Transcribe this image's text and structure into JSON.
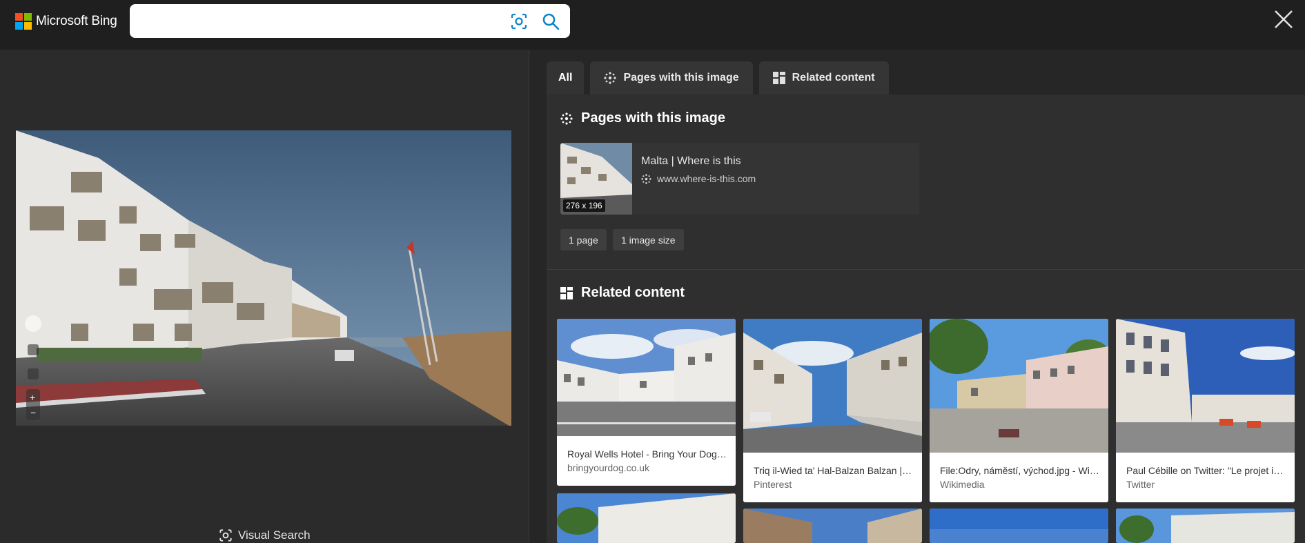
{
  "header": {
    "logo_text": "Microsoft Bing",
    "search": {
      "value": "",
      "placeholder": ""
    },
    "icons": [
      "visual-search-icon",
      "search-icon",
      "close-icon"
    ]
  },
  "left": {
    "visual_search_label": "Visual Search"
  },
  "tabs": [
    {
      "label": "All",
      "active": true
    },
    {
      "label": "Pages with this image",
      "icon": "globe-icon"
    },
    {
      "label": "Related content",
      "icon": "grid-icon"
    }
  ],
  "pages_section": {
    "title": "Pages with this image",
    "item": {
      "thumb_size": "276 x 196",
      "title": "Malta | Where is this",
      "url": "www.where-is-this.com"
    },
    "chips": [
      "1 page",
      "1 image size"
    ]
  },
  "related_section": {
    "title": "Related content",
    "cards": [
      {
        "title": "Royal Wells Hotel - Bring Your Dog - ...",
        "source": "bringyourdog.co.uk"
      },
      {
        "title": "Triq il-Wied ta' Hal-Balzan Balzan | S...",
        "source": "Pinterest"
      },
      {
        "title": "File:Odry, náměstí, východ.jpg - Wiki...",
        "source": "Wikimedia"
      },
      {
        "title": "Paul Cébille on Twitter: \"Le projet im...",
        "source": "Twitter"
      }
    ]
  },
  "colors": {
    "accent": "#0d84c9",
    "header_bg": "#1f1f1f",
    "panel_bg": "#2b2b2b"
  }
}
